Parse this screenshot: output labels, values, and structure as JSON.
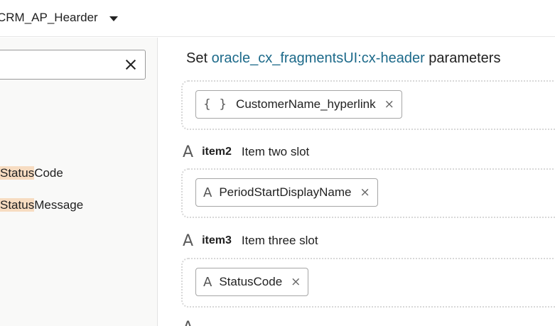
{
  "topbar": {
    "fragment_name": "CRM_AP_Hearder",
    "dropdown_icon": "caret-down-icon"
  },
  "left_pane": {
    "search": {
      "value": "",
      "clear_icon": "close-icon"
    },
    "results": [
      {
        "match": "Status",
        "rest": "Code"
      },
      {
        "match": "Status",
        "rest": "Message"
      }
    ]
  },
  "right_pane": {
    "title_prefix": "Set",
    "title_link": "oracle_cx_fragmentsUI:cx-header",
    "title_suffix": "parameters",
    "slots": [
      {
        "key": "",
        "description": "",
        "chip_icon": "curly-braces-icon",
        "chip_label": "CustomerName_hyperlink"
      },
      {
        "key": "item2",
        "description": "Item two slot",
        "chip_icon": "text-type-icon",
        "chip_label": "PeriodStartDisplayName"
      },
      {
        "key": "item3",
        "description": "Item three slot",
        "chip_icon": "text-type-icon",
        "chip_label": "StatusCode"
      }
    ]
  },
  "colors": {
    "link": "#1d6a8a",
    "highlight": "#f7dcc1",
    "left_pane_bg": "#f9f9f8"
  }
}
